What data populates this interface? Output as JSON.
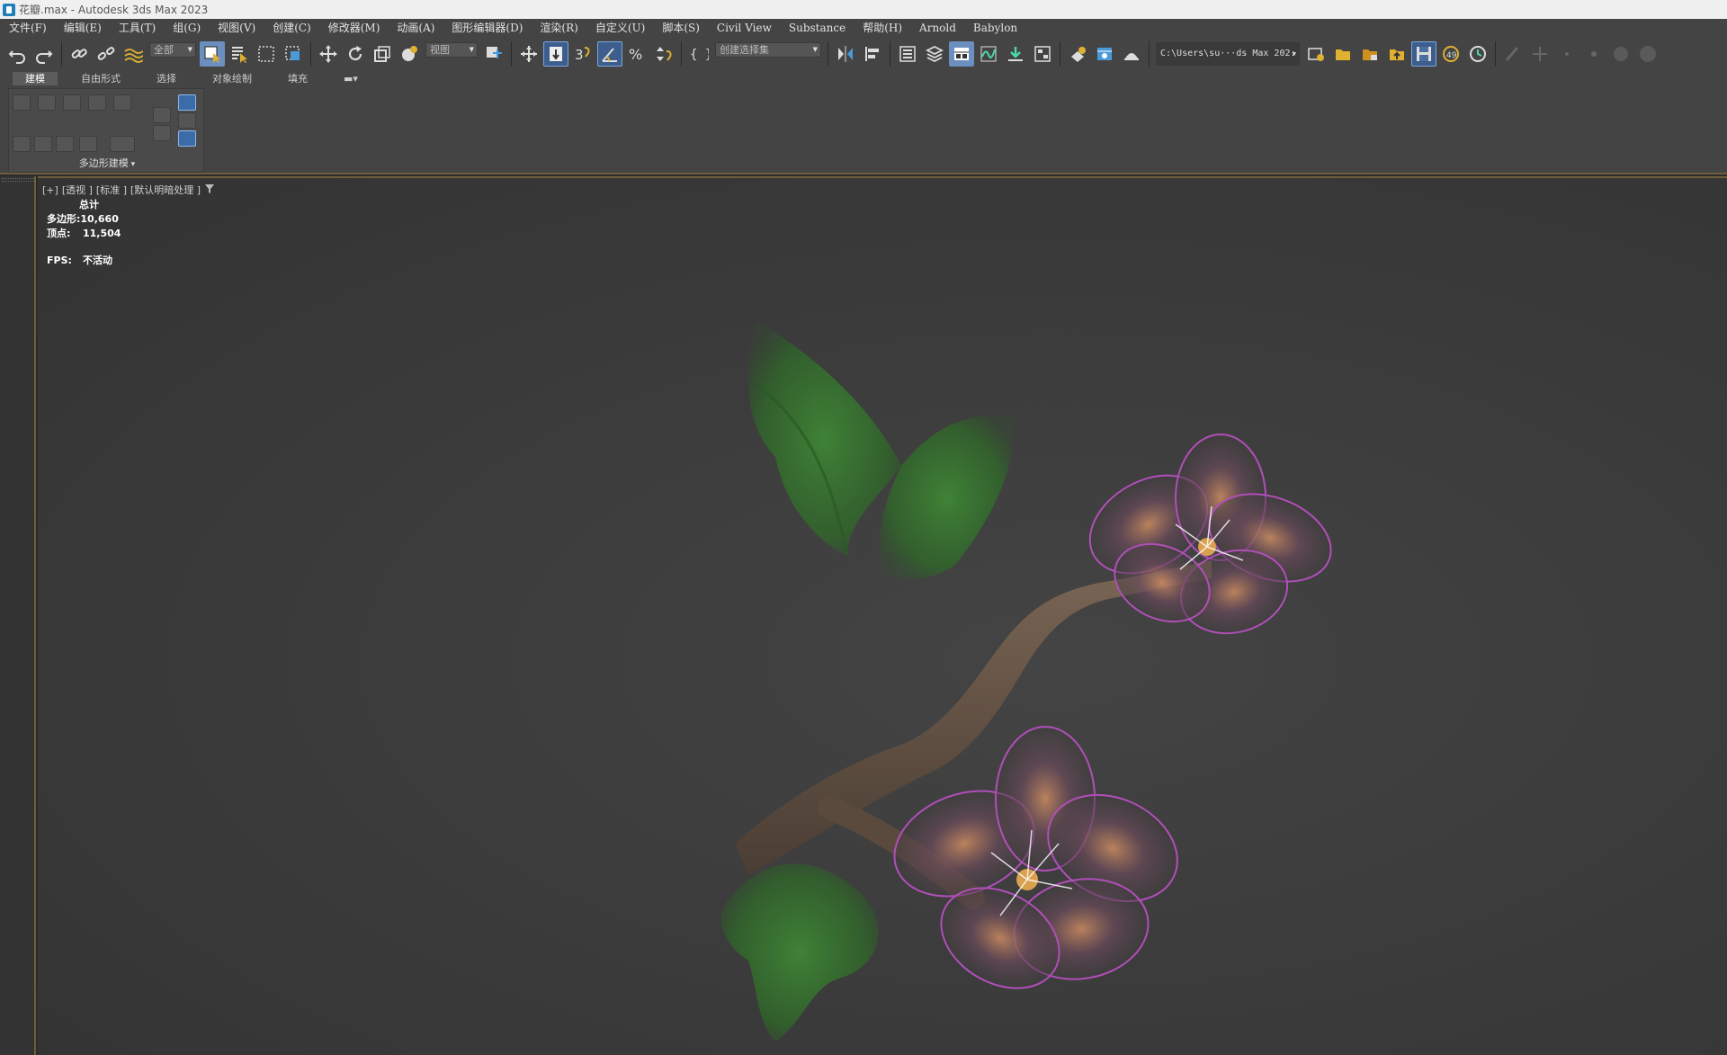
{
  "window": {
    "title": "花瓣.max - Autodesk 3ds Max 2023"
  },
  "menubar": {
    "items": [
      "文件(F)",
      "编辑(E)",
      "工具(T)",
      "组(G)",
      "视图(V)",
      "创建(C)",
      "修改器(M)",
      "动画(A)",
      "图形编辑器(D)",
      "渲染(R)",
      "自定义(U)",
      "脚本(S)",
      "Civil View",
      "Substance",
      "帮助(H)",
      "Arnold",
      "Babylon"
    ]
  },
  "toolbar": {
    "selection_filter": "全部",
    "reference_coordinate": "视图",
    "named_selection_set": "创建选择集",
    "project_path": "C:\\Users\\su···ds Max 202:",
    "icons": [
      "undo-icon",
      "redo-icon",
      "link-icon",
      "unlink-icon",
      "bind-spacewarp-icon",
      "select-object-icon",
      "select-by-name-icon",
      "rectangular-region-icon",
      "window-crossing-icon",
      "move-icon",
      "rotate-icon",
      "scale-icon",
      "placement-icon",
      "pivot-icon",
      "select-manipulate-icon",
      "keyboard-shortcut-toggle-icon",
      "snaps-toggle-icon",
      "angle-snap-icon",
      "percent-snap-icon",
      "spinner-snap-icon",
      "edit-named-selection-icon",
      "mirror-icon",
      "align-icon",
      "scene-explorer-icon",
      "layer-explorer-icon",
      "toggle-ribbon-icon",
      "curve-editor-icon",
      "schematic-view-icon",
      "material-editor-icon",
      "render-setup-icon",
      "rendered-frame-window-icon",
      "render-icon"
    ]
  },
  "ribbon": {
    "tabs": [
      "建模",
      "自由形式",
      "选择",
      "对象绘制",
      "填充"
    ],
    "active_tab": "建模",
    "group_label": "多边形建模"
  },
  "viewport": {
    "label_plus": "[+]",
    "label_view": "[透视 ]",
    "label_shading": "[标准 ]",
    "label_lighting": "[默认明暗处理 ]",
    "stats_header": "总计",
    "polys_label": "多边形:",
    "polys_value": "10,660",
    "verts_label": "顶点:",
    "verts_value": "11,504",
    "fps_label": "FPS:",
    "fps_value": "不活动"
  },
  "colors": {
    "accent_gold": "#6e5f3a",
    "active_button": "#6b8fbf",
    "viewport_bg": "#3c3c3c",
    "leaf": "#3f8a35",
    "petal_edge": "#b04fb8",
    "branch": "#6b5a4a"
  }
}
